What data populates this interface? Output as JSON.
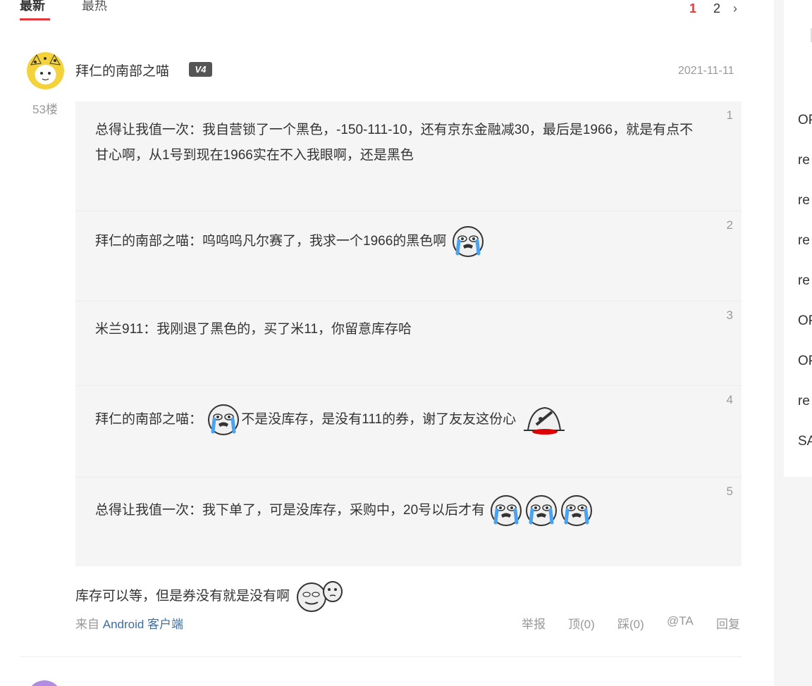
{
  "tabs": {
    "latest": "最新",
    "hottest": "最热"
  },
  "pagination": {
    "current": "1",
    "page2": "2",
    "next": "›"
  },
  "post": {
    "username": "拜仁的南部之喵",
    "level": "V4",
    "date": "2021-11-11",
    "floor": "53楼",
    "content": "库存可以等，但是券没有就是没有啊",
    "from_prefix": "来自 ",
    "client": "Android 客户端"
  },
  "quote_items": [
    {
      "who": "总得让我值一次：",
      "text": "我自营锁了一个黑色，-150-111-10，还有京东金融减30，最后是1966，就是有点不甘心啊，从1号到现在1966实在不入我眼啊，还是黑色",
      "num": "1"
    },
    {
      "who": "拜仁的南部之喵：",
      "text": "呜呜呜凡尔赛了，我求一个1966的黑色啊",
      "num": "2"
    },
    {
      "who": "米兰911：",
      "text": "我刚退了黑色的，买了米11，你留意库存哈",
      "num": "3"
    },
    {
      "who": "拜仁的南部之喵：",
      "text": "不是没库存，是没有111的券，谢了友友这份心",
      "num": "4"
    },
    {
      "who": "总得让我值一次：",
      "text": "我下单了，可是没库存，采购中，20号以后才有",
      "num": "5"
    }
  ],
  "actions": {
    "report": "举报",
    "up": "顶(0)",
    "down": "踩(0)",
    "at": "@TA",
    "reply": "回复"
  },
  "sidebar": {
    "items": [
      "OP",
      "re",
      "re",
      "re",
      "re",
      "OP",
      "OP",
      "re",
      "SA"
    ]
  },
  "icons": {
    "crying": "crying-face-icon",
    "knife": "knife-head-icon",
    "faces": "two-faces-icon"
  },
  "colors": {
    "accent": "#e4393c",
    "link": "#3f6e9e",
    "quote_bg": "#f5f5f5"
  }
}
